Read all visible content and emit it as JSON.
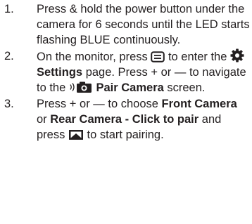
{
  "steps": [
    {
      "number": "1.",
      "text": "Press & hold the power button under the camera for 6 seconds until the LED starts flashing BLUE continuously."
    },
    {
      "number": "2.",
      "part1": "On the monitor, press",
      "part2": "to enter the",
      "settings_label": "Settings",
      "part3": "page. Press",
      "plus": "+",
      "or": "or",
      "minus": "—",
      "part4": "to navigate to the",
      "pair_label": "Pair Camera",
      "part5": "screen.",
      "icons": [
        "menu-key-icon",
        "gear-icon",
        "pair-camera-icon"
      ]
    },
    {
      "number": "3.",
      "part1": "Press",
      "plus": "+",
      "or": "or",
      "minus": "—",
      "part2": "to choose",
      "front_camera": "Front Camera",
      "or2": "or",
      "rear_camera": "Rear Camera  - Click to pair",
      "part3": "and press",
      "part4": "to start pairing.",
      "icons": [
        "ok-key-icon"
      ]
    }
  ]
}
